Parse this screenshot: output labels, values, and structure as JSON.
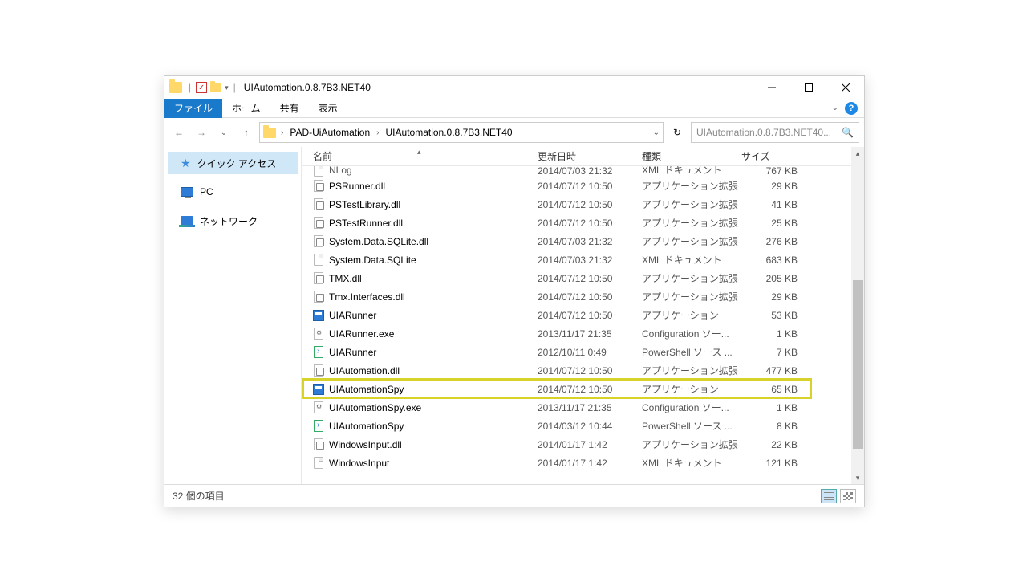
{
  "titlebar": {
    "title": "UIAutomation.0.8.7B3.NET40"
  },
  "tabs": {
    "file": "ファイル",
    "home": "ホーム",
    "share": "共有",
    "view": "表示"
  },
  "breadcrumbs": {
    "parent": "PAD-UiAutomation",
    "current": "UIAutomation.0.8.7B3.NET40"
  },
  "search": {
    "placeholder": "UIAutomation.0.8.7B3.NET40..."
  },
  "navpane": {
    "quick": "クイック アクセス",
    "pc": "PC",
    "network": "ネットワーク"
  },
  "columns": {
    "name": "名前",
    "date": "更新日時",
    "type": "種類",
    "size": "サイズ"
  },
  "rows": [
    {
      "icon": "file",
      "name": "NLog",
      "date": "2014/07/03 21:32",
      "type": "XML ドキュメント",
      "size": "767 KB",
      "clipped": true
    },
    {
      "icon": "dll",
      "name": "PSRunner.dll",
      "date": "2014/07/12 10:50",
      "type": "アプリケーション拡張",
      "size": "29 KB"
    },
    {
      "icon": "dll",
      "name": "PSTestLibrary.dll",
      "date": "2014/07/12 10:50",
      "type": "アプリケーション拡張",
      "size": "41 KB"
    },
    {
      "icon": "dll",
      "name": "PSTestRunner.dll",
      "date": "2014/07/12 10:50",
      "type": "アプリケーション拡張",
      "size": "25 KB"
    },
    {
      "icon": "dll",
      "name": "System.Data.SQLite.dll",
      "date": "2014/07/03 21:32",
      "type": "アプリケーション拡張",
      "size": "276 KB"
    },
    {
      "icon": "file",
      "name": "System.Data.SQLite",
      "date": "2014/07/03 21:32",
      "type": "XML ドキュメント",
      "size": "683 KB"
    },
    {
      "icon": "dll",
      "name": "TMX.dll",
      "date": "2014/07/12 10:50",
      "type": "アプリケーション拡張",
      "size": "205 KB"
    },
    {
      "icon": "dll",
      "name": "Tmx.Interfaces.dll",
      "date": "2014/07/12 10:50",
      "type": "アプリケーション拡張",
      "size": "29 KB"
    },
    {
      "icon": "exe",
      "name": "UIARunner",
      "date": "2014/07/12 10:50",
      "type": "アプリケーション",
      "size": "53 KB"
    },
    {
      "icon": "cfg",
      "name": "UIARunner.exe",
      "date": "2013/11/17 21:35",
      "type": "Configuration ソー...",
      "size": "1 KB"
    },
    {
      "icon": "ps1",
      "name": "UIARunner",
      "date": "2012/10/11 0:49",
      "type": "PowerShell ソース ...",
      "size": "7 KB"
    },
    {
      "icon": "dll",
      "name": "UIAutomation.dll",
      "date": "2014/07/12 10:50",
      "type": "アプリケーション拡張",
      "size": "477 KB"
    },
    {
      "icon": "exe",
      "name": "UIAutomationSpy",
      "date": "2014/07/12 10:50",
      "type": "アプリケーション",
      "size": "65 KB",
      "highlight": true
    },
    {
      "icon": "cfg",
      "name": "UIAutomationSpy.exe",
      "date": "2013/11/17 21:35",
      "type": "Configuration ソー...",
      "size": "1 KB"
    },
    {
      "icon": "ps1",
      "name": "UIAutomationSpy",
      "date": "2014/03/12 10:44",
      "type": "PowerShell ソース ...",
      "size": "8 KB"
    },
    {
      "icon": "dll",
      "name": "WindowsInput.dll",
      "date": "2014/01/17 1:42",
      "type": "アプリケーション拡張",
      "size": "22 KB"
    },
    {
      "icon": "file",
      "name": "WindowsInput",
      "date": "2014/01/17 1:42",
      "type": "XML ドキュメント",
      "size": "121 KB"
    }
  ],
  "status": {
    "count": "32 個の項目"
  }
}
